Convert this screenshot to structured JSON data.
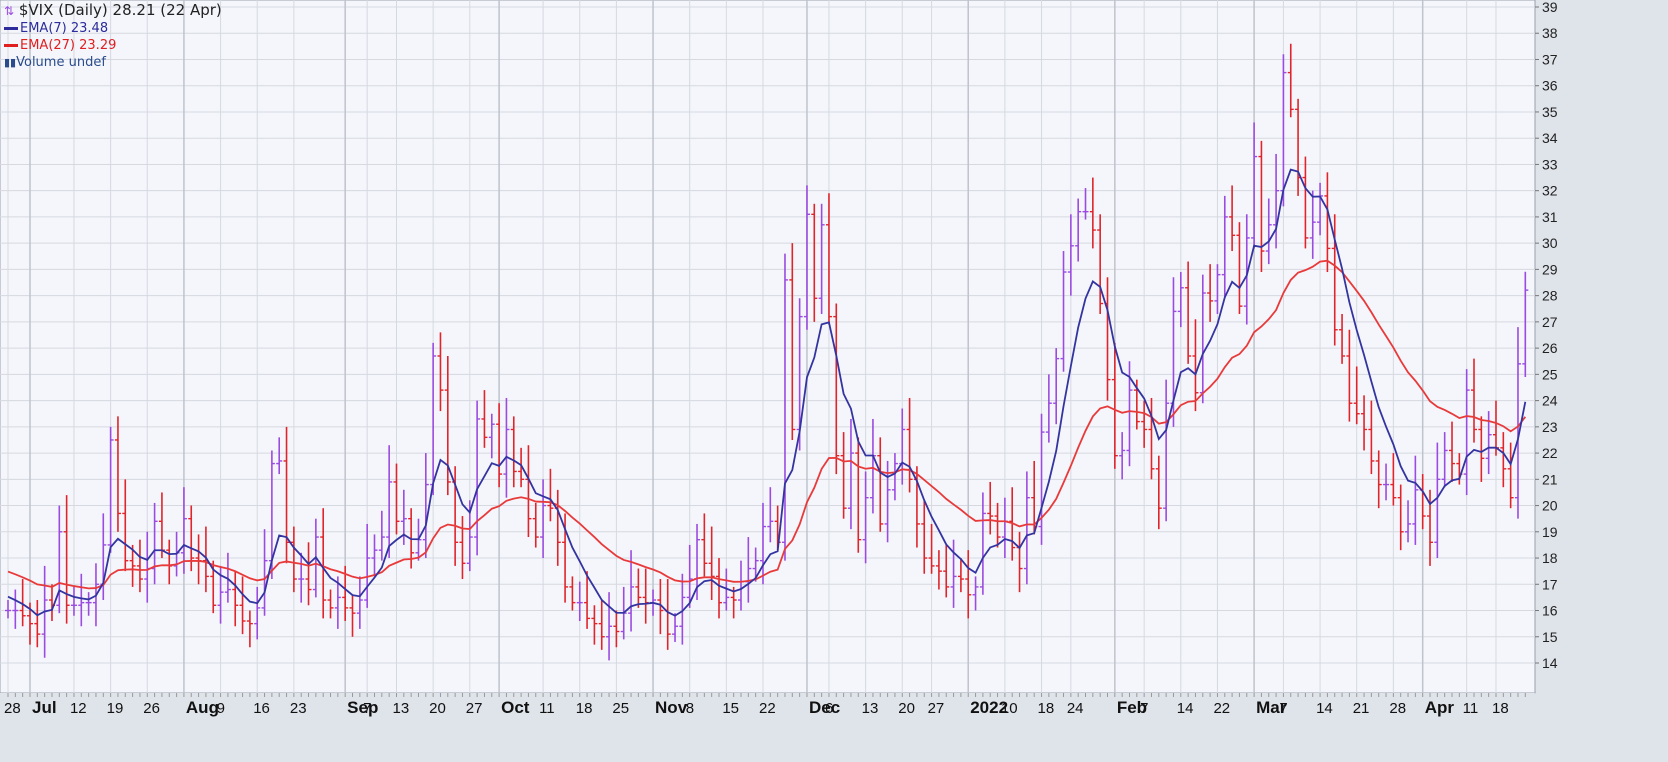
{
  "legend": {
    "title": "$VIX (Daily) 28.21 (22 Apr)",
    "ema7": "EMA(7) 23.48",
    "ema27": "EMA(27) 23.29",
    "volume": "Volume undef"
  },
  "colors": {
    "up": "#9b4be0",
    "down": "#e0242a",
    "ema7": "#3434a0",
    "ema27": "#e83a3a",
    "bg": "#f4f6fb",
    "grid": "#d6d9e0"
  },
  "chart_data": {
    "type": "ohlc",
    "title": "$VIX (Daily)",
    "ylim": [
      13.3,
      39.2
    ],
    "y_ticks": [
      14,
      15,
      16,
      17,
      18,
      19,
      20,
      21,
      22,
      23,
      24,
      25,
      26,
      27,
      28,
      29,
      30,
      31,
      32,
      33,
      34,
      35,
      36,
      37,
      38,
      39
    ],
    "x_ticks": [
      {
        "label": "28",
        "bold": false,
        "bar": 0
      },
      {
        "label": "Jul",
        "bold": true,
        "bar": 3
      },
      {
        "label": "12",
        "bold": false,
        "bar": 9
      },
      {
        "label": "19",
        "bold": false,
        "bar": 14
      },
      {
        "label": "26",
        "bold": false,
        "bar": 19
      },
      {
        "label": "Aug",
        "bold": true,
        "bar": 24
      },
      {
        "label": "9",
        "bold": false,
        "bar": 29
      },
      {
        "label": "16",
        "bold": false,
        "bar": 34
      },
      {
        "label": "23",
        "bold": false,
        "bar": 39
      },
      {
        "label": "Sep",
        "bold": true,
        "bar": 46
      },
      {
        "label": "7",
        "bold": false,
        "bar": 49
      },
      {
        "label": "13",
        "bold": false,
        "bar": 53
      },
      {
        "label": "20",
        "bold": false,
        "bar": 58
      },
      {
        "label": "27",
        "bold": false,
        "bar": 63
      },
      {
        "label": "Oct",
        "bold": true,
        "bar": 67
      },
      {
        "label": "11",
        "bold": false,
        "bar": 73
      },
      {
        "label": "18",
        "bold": false,
        "bar": 78
      },
      {
        "label": "25",
        "bold": false,
        "bar": 83
      },
      {
        "label": "Nov",
        "bold": true,
        "bar": 88
      },
      {
        "label": "8",
        "bold": false,
        "bar": 93
      },
      {
        "label": "15",
        "bold": false,
        "bar": 98
      },
      {
        "label": "22",
        "bold": false,
        "bar": 103
      },
      {
        "label": "Dec",
        "bold": true,
        "bar": 109
      },
      {
        "label": "6",
        "bold": false,
        "bar": 112
      },
      {
        "label": "13",
        "bold": false,
        "bar": 117
      },
      {
        "label": "20",
        "bold": false,
        "bar": 122
      },
      {
        "label": "27",
        "bold": false,
        "bar": 126
      },
      {
        "label": "2022",
        "bold": true,
        "bar": 131
      },
      {
        "label": "10",
        "bold": false,
        "bar": 136
      },
      {
        "label": "18",
        "bold": false,
        "bar": 141
      },
      {
        "label": "24",
        "bold": false,
        "bar": 145
      },
      {
        "label": "Feb",
        "bold": true,
        "bar": 151
      },
      {
        "label": "7",
        "bold": false,
        "bar": 155
      },
      {
        "label": "14",
        "bold": false,
        "bar": 160
      },
      {
        "label": "22",
        "bold": false,
        "bar": 165
      },
      {
        "label": "Mar",
        "bold": true,
        "bar": 170
      },
      {
        "label": "7",
        "bold": false,
        "bar": 174
      },
      {
        "label": "14",
        "bold": false,
        "bar": 179
      },
      {
        "label": "21",
        "bold": false,
        "bar": 184
      },
      {
        "label": "28",
        "bold": false,
        "bar": 189
      },
      {
        "label": "Apr",
        "bold": true,
        "bar": 193
      },
      {
        "label": "11",
        "bold": false,
        "bar": 199
      },
      {
        "label": "18",
        "bold": false,
        "bar": 203
      }
    ],
    "close": [
      16.0,
      16.0,
      15.8,
      15.5,
      15.1,
      16.4,
      16.2,
      19.0,
      16.2,
      16.2,
      16.3,
      16.3,
      17.0,
      18.5,
      22.5,
      19.7,
      17.9,
      17.7,
      17.2,
      17.6,
      19.4,
      18.3,
      17.7,
      18.2,
      19.5,
      18.0,
      17.9,
      17.3,
      16.2,
      16.7,
      16.8,
      16.2,
      15.6,
      15.5,
      16.1,
      17.9,
      21.6,
      21.7,
      18.6,
      17.2,
      17.2,
      16.8,
      18.8,
      16.4,
      16.1,
      16.5,
      16.1,
      15.9,
      16.4,
      18.0,
      18.3,
      18.8,
      20.9,
      19.4,
      19.5,
      18.2,
      18.7,
      20.8,
      25.7,
      24.4,
      20.9,
      18.6,
      17.8,
      18.8,
      23.3,
      22.6,
      23.1,
      21.2,
      22.9,
      21.3,
      21.0,
      19.5,
      18.8,
      20.0,
      19.9,
      18.6,
      16.9,
      16.3,
      16.3,
      15.7,
      15.5,
      15.0,
      15.4,
      15.2,
      15.9,
      16.9,
      16.5,
      16.3,
      16.4,
      16.0,
      15.1,
      15.4,
      16.5,
      17.2,
      18.7,
      17.8,
      17.3,
      16.3,
      16.5,
      16.4,
      17.1,
      17.6,
      17.9,
      19.2,
      19.4,
      18.6,
      28.6,
      22.9,
      27.2,
      31.1,
      27.9,
      30.7,
      27.2,
      21.9,
      19.9,
      22.0,
      18.7,
      20.3,
      21.9,
      19.3,
      20.6,
      21.6,
      22.9,
      21.0,
      19.3,
      18.0,
      17.7,
      17.5,
      16.9,
      17.3,
      17.2,
      16.6,
      16.9,
      19.7,
      19.6,
      18.8,
      19.4,
      18.4,
      17.6,
      20.3,
      19.2,
      22.8,
      23.9,
      25.6,
      28.9,
      29.9,
      31.2,
      31.2,
      30.5,
      27.7,
      24.8,
      21.9,
      22.1,
      24.4,
      23.2,
      22.9,
      21.4,
      19.9,
      23.9,
      27.4,
      28.3,
      25.7,
      24.3,
      28.1,
      27.8,
      28.8,
      31.0,
      30.3,
      27.6,
      30.2,
      33.3,
      29.7,
      30.7,
      32.0,
      36.5,
      35.1,
      32.5,
      30.2,
      30.8,
      31.8,
      29.8,
      26.7,
      25.7,
      23.9,
      23.5,
      22.9,
      21.7,
      20.8,
      20.8,
      20.3,
      19.0,
      19.3,
      20.6,
      19.6,
      18.6,
      21.0,
      22.1,
      21.6,
      21.2,
      24.4,
      22.9,
      21.8,
      22.7,
      22.2,
      21.4,
      20.3,
      25.4,
      28.21
    ],
    "series": [
      {
        "name": "EMA(7)",
        "last": 23.48
      },
      {
        "name": "EMA(27)",
        "last": 23.29
      }
    ]
  }
}
